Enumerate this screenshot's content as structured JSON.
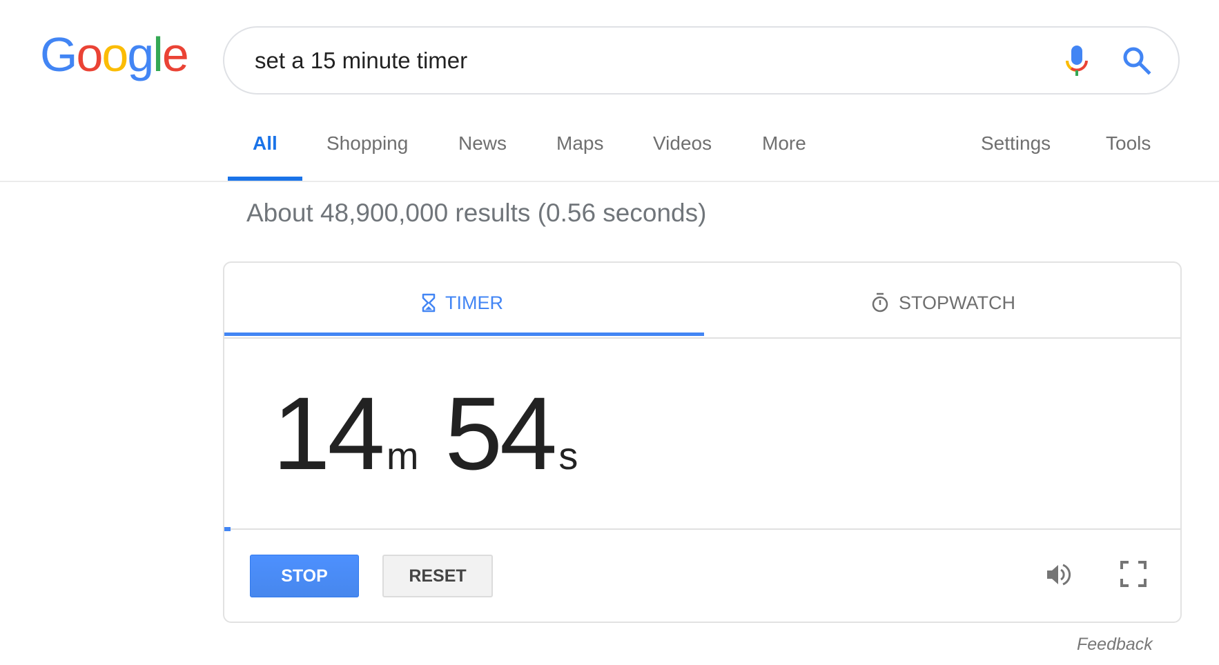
{
  "logo": {
    "letters": [
      "G",
      "o",
      "o",
      "g",
      "l",
      "e"
    ],
    "colors": [
      "#4285f4",
      "#ea4335",
      "#fbbc05",
      "#4285f4",
      "#34a853",
      "#ea4335"
    ]
  },
  "search": {
    "query": "set a 15 minute timer",
    "mic_icon": "microphone-icon",
    "search_icon": "search-icon"
  },
  "nav": {
    "tabs": [
      {
        "label": "All",
        "active": true
      },
      {
        "label": "Shopping"
      },
      {
        "label": "News"
      },
      {
        "label": "Maps"
      },
      {
        "label": "Videos"
      },
      {
        "label": "More"
      }
    ],
    "right": [
      {
        "label": "Settings"
      },
      {
        "label": "Tools"
      }
    ]
  },
  "results_stats": "About 48,900,000 results (0.56 seconds)",
  "widget": {
    "tabs": [
      {
        "label": "TIMER",
        "icon": "hourglass-icon",
        "active": true
      },
      {
        "label": "STOPWATCH",
        "icon": "stopwatch-icon"
      }
    ],
    "time": {
      "minutes": "14",
      "minutes_unit": "m",
      "seconds": "54",
      "seconds_unit": "s"
    },
    "progress_fraction": 0.0067,
    "buttons": {
      "stop": "STOP",
      "reset": "RESET"
    },
    "volume_icon": "volume-icon",
    "fullscreen_icon": "fullscreen-icon"
  },
  "feedback": "Feedback",
  "colors": {
    "accent": "#4285f4",
    "nav_active": "#1a73e8",
    "muted_text": "#70757a"
  }
}
